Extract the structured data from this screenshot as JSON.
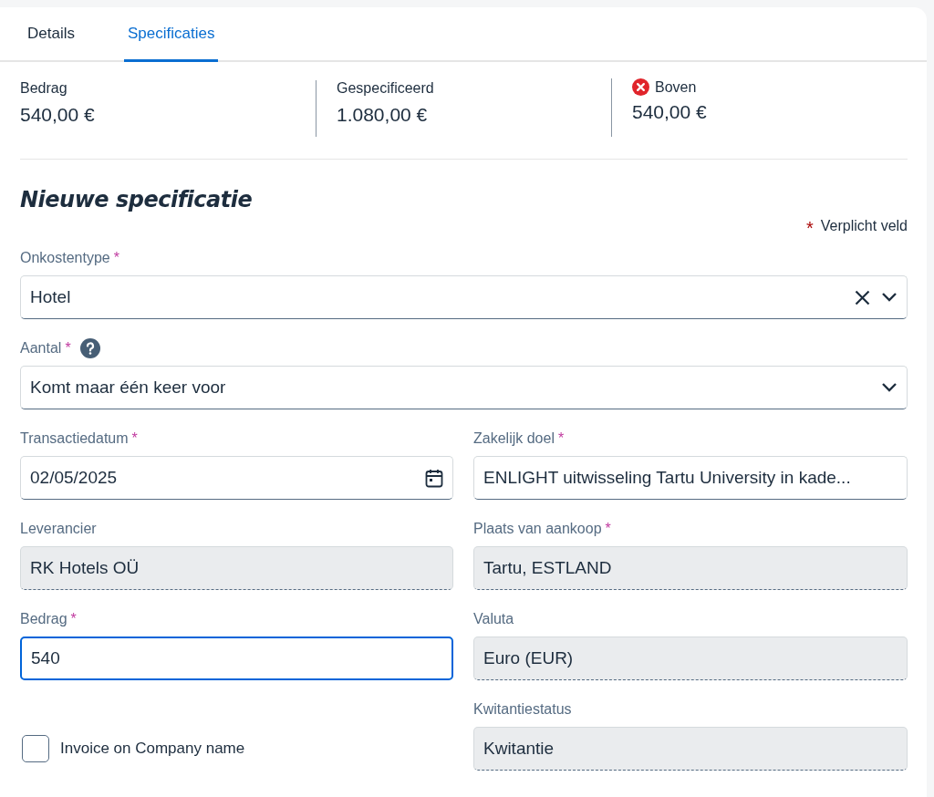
{
  "tabs": [
    {
      "label": "Details",
      "selected": false
    },
    {
      "label": "Specificaties",
      "selected": true
    }
  ],
  "summary": [
    {
      "label": "Bedrag",
      "value": "540,00 €",
      "error": false
    },
    {
      "label": "Gespecificeerd",
      "value": "1.080,00 €",
      "error": false
    },
    {
      "label": "Boven",
      "value": "540,00 €",
      "error": true
    }
  ],
  "form": {
    "title": "Nieuwe specificatie",
    "required_legend": {
      "mark": "*",
      "text": "Verplicht veld"
    },
    "full_fields": [
      {
        "kind": "dropdown",
        "label": "Onkostentype",
        "required": true,
        "help": false,
        "value": "Hotel",
        "clearable": true
      },
      {
        "kind": "dropdown",
        "label": "Aantal",
        "required": true,
        "help": true,
        "value": "Komt maar één keer voor",
        "clearable": false
      }
    ],
    "grid_fields": [
      {
        "kind": "date",
        "label": "Transactiedatum",
        "required": true,
        "value": "02/05/2025"
      },
      {
        "kind": "text",
        "label": "Zakelijk doel",
        "required": true,
        "value": "ENLIGHT uitwisseling Tartu University in kade..."
      },
      {
        "kind": "readonly",
        "label": "Leverancier",
        "required": false,
        "value": "RK Hotels OÜ"
      },
      {
        "kind": "readonly",
        "label": "Plaats van aankoop",
        "required": true,
        "value": "Tartu, ESTLAND"
      },
      {
        "kind": "text",
        "label": "Bedrag",
        "required": true,
        "value": "540",
        "focused": true
      },
      {
        "kind": "readonly",
        "label": "Valuta",
        "required": false,
        "value": "Euro (EUR)"
      },
      {
        "kind": "checkbox",
        "label": "Invoice on Company name",
        "checked": false
      },
      {
        "kind": "readonly",
        "label": "Kwitantiestatus",
        "required": false,
        "value": "Kwitantie"
      }
    ]
  }
}
